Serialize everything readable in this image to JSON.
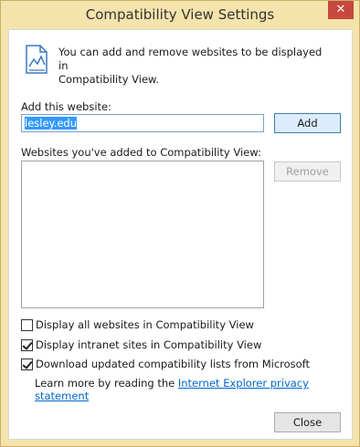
{
  "window": {
    "title": "Compatibility View Settings",
    "close_glyph": "✕"
  },
  "info": {
    "line1": "You can add and remove websites to be displayed in",
    "line2": "Compatibility View.",
    "icon": "document-chart-icon"
  },
  "add_site": {
    "label": "Add this website:",
    "value": "lesley.edu",
    "add_button": "Add"
  },
  "sites_list": {
    "label": "Websites you've added to Compatibility View:",
    "items": [],
    "remove_button": "Remove"
  },
  "options": [
    {
      "label": "Display all websites in Compatibility View",
      "checked": false
    },
    {
      "label": "Display intranet sites in Compatibility View",
      "checked": true
    },
    {
      "label": "Download updated compatibility lists from Microsoft",
      "checked": true
    }
  ],
  "learn_more": {
    "prefix": "Learn more by reading the ",
    "link_text": "Internet Explorer privacy statement"
  },
  "footer": {
    "close_button": "Close"
  },
  "colors": {
    "frame": "#f4e3ab",
    "close_button_bg": "#c7483c",
    "link": "#0066cc",
    "selection": "#3399ff"
  }
}
